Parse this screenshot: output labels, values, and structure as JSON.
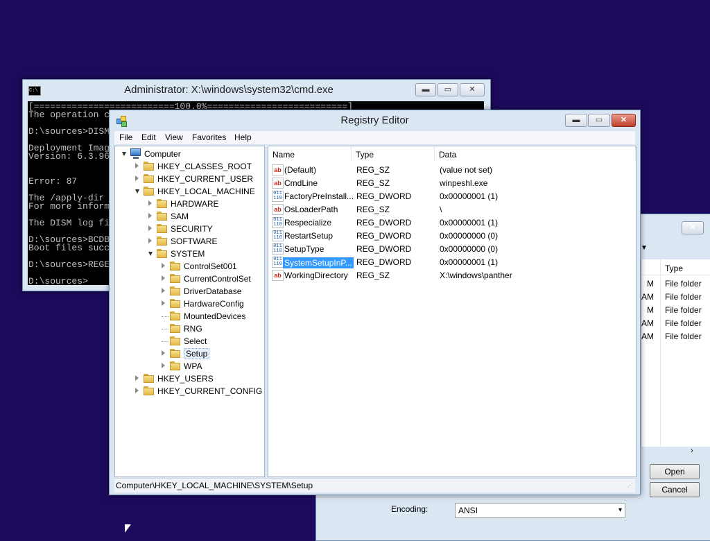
{
  "cmd": {
    "title": "Administrator: X:\\windows\\system32\\cmd.exe",
    "icon": "cmd-icon",
    "lines": [
      "[==========================100.0%==========================]",
      "The operation c",
      "",
      "D:\\sources>DISM",
      "",
      "Deployment Imag",
      "Version: 6.3.96",
      "",
      "",
      "Error: 87",
      "",
      "The /apply-dir",
      "For more inform",
      "",
      "The DISM log fi",
      "",
      "D:\\sources>BCDB",
      "Boot files succ",
      "",
      "D:\\sources>REGE",
      "",
      "D:\\sources>"
    ]
  },
  "registry": {
    "title": "Registry Editor",
    "menu": [
      "File",
      "Edit",
      "View",
      "Favorites",
      "Help"
    ],
    "tree": {
      "root": "Computer",
      "hives": [
        "HKEY_CLASSES_ROOT",
        "HKEY_CURRENT_USER",
        "HKEY_LOCAL_MACHINE"
      ],
      "hklm_children": [
        "HARDWARE",
        "SAM",
        "SECURITY",
        "SOFTWARE",
        "SYSTEM"
      ],
      "system_children": [
        "ControlSet001",
        "CurrentControlSet",
        "DriverDatabase",
        "HardwareConfig",
        "MountedDevices",
        "RNG",
        "Select",
        "Setup",
        "WPA"
      ],
      "more_hives": [
        "HKEY_USERS",
        "HKEY_CURRENT_CONFIG"
      ]
    },
    "columns": [
      "Name",
      "Type",
      "Data"
    ],
    "values": [
      {
        "name": "(Default)",
        "type": "REG_SZ",
        "data": "(value not set)",
        "kind": "sz"
      },
      {
        "name": "CmdLine",
        "type": "REG_SZ",
        "data": "winpeshl.exe",
        "kind": "sz"
      },
      {
        "name": "FactoryPreInstall...",
        "type": "REG_DWORD",
        "data": "0x00000001 (1)",
        "kind": "dw"
      },
      {
        "name": "OsLoaderPath",
        "type": "REG_SZ",
        "data": "\\",
        "kind": "sz"
      },
      {
        "name": "Respecialize",
        "type": "REG_DWORD",
        "data": "0x00000001 (1)",
        "kind": "dw"
      },
      {
        "name": "RestartSetup",
        "type": "REG_DWORD",
        "data": "0x00000000 (0)",
        "kind": "dw"
      },
      {
        "name": "SetupType",
        "type": "REG_DWORD",
        "data": "0x00000000 (0)",
        "kind": "dw"
      },
      {
        "name": "SystemSetupInP...",
        "type": "REG_DWORD",
        "data": "0x00000001 (1)",
        "kind": "dw"
      },
      {
        "name": "WorkingDirectory",
        "type": "REG_SZ",
        "data": "X:\\windows\\panther",
        "kind": "sz"
      }
    ],
    "status_path": "Computer\\HKEY_LOCAL_MACHINE\\SYSTEM\\Setup"
  },
  "dialog": {
    "type_header": "Type",
    "rows": [
      {
        "time": "M",
        "type": "File folder"
      },
      {
        "time": "AM",
        "type": "File folder"
      },
      {
        "time": "M",
        "type": "File folder"
      },
      {
        "time": "AM",
        "type": "File folder"
      },
      {
        "time": "AM",
        "type": "File folder"
      }
    ],
    "open_label": "Open",
    "cancel_label": "Cancel",
    "encoding_label": "Encoding:",
    "encoding_value": "ANSI"
  },
  "colors": {
    "desktop": "#1c0a5c",
    "selection": "#3399ff"
  }
}
